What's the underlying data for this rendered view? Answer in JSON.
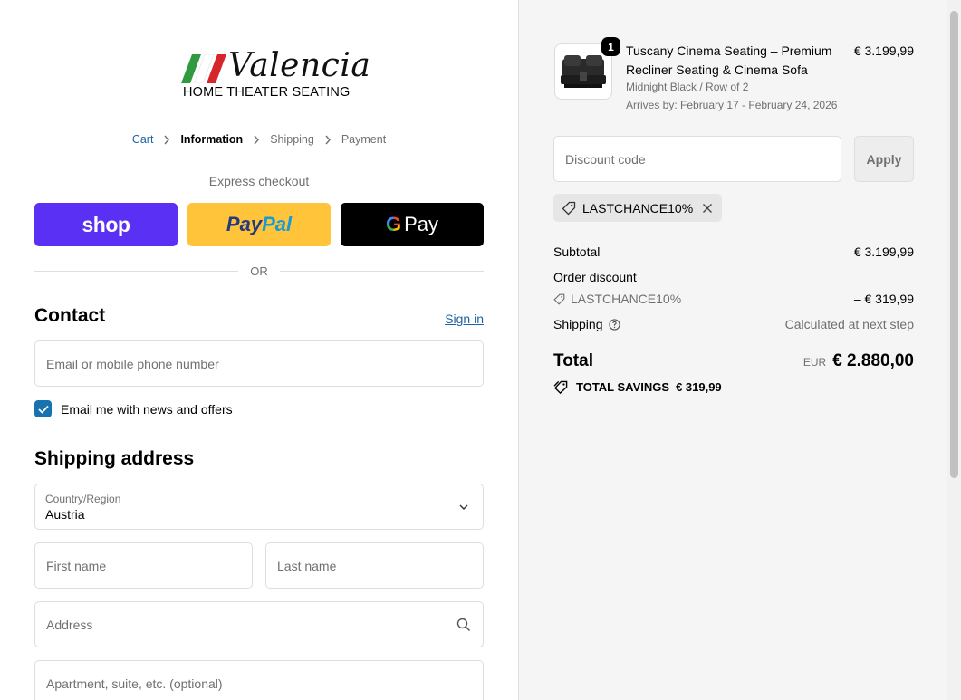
{
  "brand": {
    "name": "Valencia",
    "tagline": "HOME THEATER SEATING"
  },
  "breadcrumb": [
    {
      "label": "Cart",
      "state": "link"
    },
    {
      "label": "Information",
      "state": "active"
    },
    {
      "label": "Shipping",
      "state": "inactive"
    },
    {
      "label": "Payment",
      "state": "inactive"
    }
  ],
  "express": {
    "label": "Express checkout",
    "shop_label": "shop",
    "paypal_pay": "Pay",
    "paypal_pal": "Pal",
    "gpay_g": "G",
    "gpay_label": "Pay",
    "or_label": "OR"
  },
  "contact": {
    "title": "Contact",
    "signin_label": "Sign in",
    "email_placeholder": "Email or mobile phone number",
    "newsletter_label": "Email me with news and offers",
    "newsletter_checked": true
  },
  "shipping_address": {
    "title": "Shipping address",
    "country_label": "Country/Region",
    "country_value": "Austria",
    "first_name_placeholder": "First name",
    "last_name_placeholder": "Last name",
    "address_placeholder": "Address",
    "apartment_placeholder": "Apartment, suite, etc. (optional)"
  },
  "order": {
    "product": {
      "quantity": "1",
      "name": "Tuscany Cinema Seating – Premium Recliner Seating & Cinema Sofa",
      "variant": "Midnight Black / Row of 2",
      "arrival": "Arrives by: February 17 - February 24, 2026",
      "price": "€ 3.199,99"
    },
    "discount_placeholder": "Discount code",
    "apply_label": "Apply",
    "applied_code": "LASTCHANCE10%",
    "subtotal_label": "Subtotal",
    "subtotal_value": "€ 3.199,99",
    "order_discount_label": "Order discount",
    "discount_code_line": "LASTCHANCE10%",
    "discount_value": "– € 319,99",
    "shipping_label": "Shipping",
    "shipping_value": "Calculated at next step",
    "total_label": "Total",
    "currency": "EUR",
    "total_value": "€ 2.880,00",
    "savings_label": "TOTAL SAVINGS",
    "savings_value": "€ 319,99"
  },
  "colors": {
    "link": "#1f62a4",
    "shop_pay": "#5a31f4",
    "paypal": "#ffc439",
    "checkbox": "#1773b0"
  }
}
